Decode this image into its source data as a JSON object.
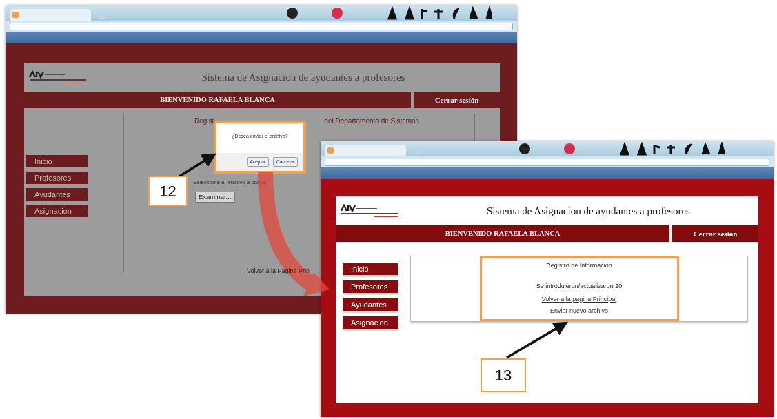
{
  "windows": [
    {
      "kind": "upload",
      "dimmed": true,
      "site_title": "Sistema de Asignacion de ayudantes a profesores",
      "welcome": "BIENVENIDO RAFAELA BLANCA",
      "logout": "Cerrar sesión",
      "menu": [
        "Inicio",
        "Profesores",
        "Ayudantes",
        "Asignacion"
      ],
      "content": {
        "heading_left": "Regist",
        "heading_right": "del Departamento de Sistemas",
        "file_prompt": "Seleccione el archivo a cargar:",
        "browse_button": "Examinar...",
        "link": "Volver a la Pagina Prin"
      },
      "dialog": {
        "message": "¿Desea enviar el archivo?",
        "buttons": [
          "Aceptar",
          "Cancelar"
        ],
        "highlighted": true
      }
    },
    {
      "kind": "result",
      "dimmed": false,
      "site_title": "Sistema de Asignacion de ayudantes a profesores",
      "welcome": "BIENVENIDO RAFAELA BLANCA",
      "logout": "Cerrar sesión",
      "menu": [
        "Inicio",
        "Profesores",
        "Ayudantes",
        "Asignacion"
      ],
      "content": {
        "heading": "Registro de Informacion",
        "message": "Se introdujeron/actualizaron 20",
        "links": [
          "Volver a la pagina Principal",
          "Enviar nuevo archivo"
        ],
        "highlighted": true
      }
    }
  ],
  "callouts": [
    {
      "label": "12"
    },
    {
      "label": "13"
    }
  ]
}
